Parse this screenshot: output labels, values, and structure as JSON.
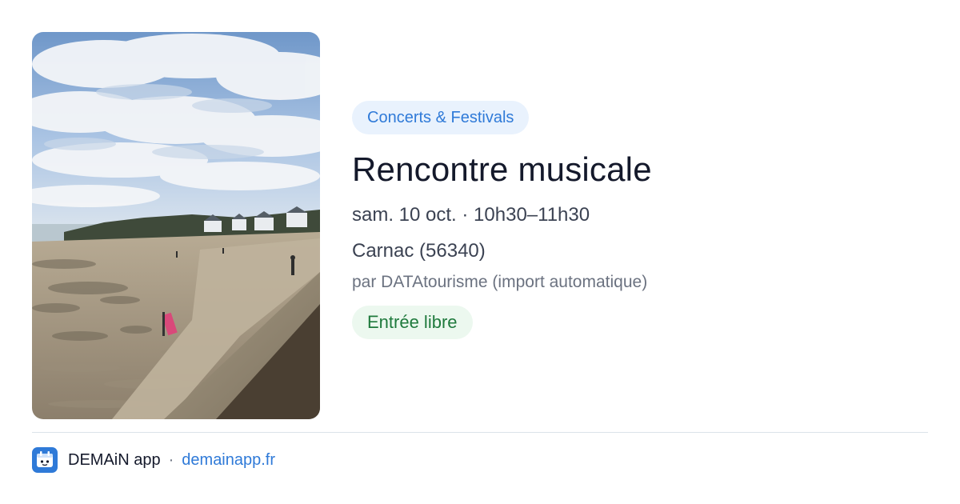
{
  "event": {
    "category": "Concerts & Festivals",
    "title": "Rencontre musicale",
    "datetime": "sam. 10 oct. · 10h30–11h30",
    "location": "Carnac (56340)",
    "source": "par DATAtourisme (import automatique)",
    "price": "Entrée libre"
  },
  "footer": {
    "app_name": "DEMAiN app",
    "separator": "·",
    "url": "demainapp.fr"
  },
  "colors": {
    "accent_blue": "#2f7ad8",
    "category_bg": "#e9f2fd",
    "price_green": "#1f7a3d",
    "price_bg": "#ecf8ef",
    "title": "#14192b",
    "muted": "#6b7280"
  },
  "icons": {
    "app": "demain-app-icon"
  }
}
